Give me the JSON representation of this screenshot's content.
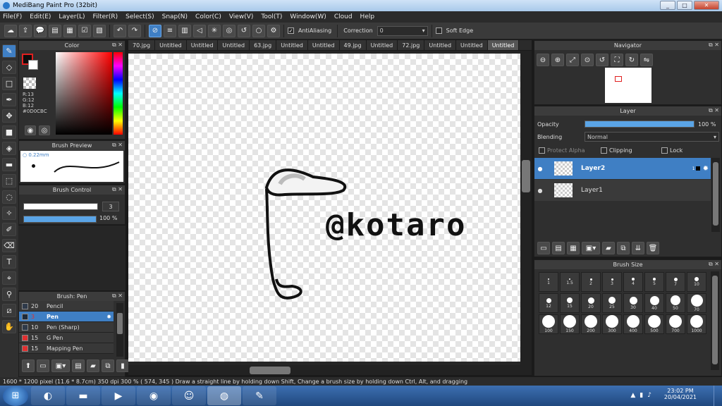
{
  "titlebar": {
    "title": "MediBang Paint Pro (32bit)",
    "min": "_",
    "max": "□",
    "close": "✕"
  },
  "menu": [
    "File(F)",
    "Edit(E)",
    "Layer(L)",
    "Filter(R)",
    "Select(S)",
    "Snap(N)",
    "Color(C)",
    "View(V)",
    "Tool(T)",
    "Window(W)",
    "Cloud",
    "Help"
  ],
  "toolbar": {
    "antialiasing_label": "AntiAliasing",
    "antialiasing_checked": "✓",
    "correction_label": "Correction",
    "correction_value": "0",
    "softedge_label": "Soft Edge"
  },
  "color": {
    "title": "Color",
    "r": "R:13",
    "g": "G:12",
    "b": "B:12",
    "hex": "#0D0CBC"
  },
  "brush_preview": {
    "title": "Brush Preview",
    "size": "0.22mm"
  },
  "brush_control": {
    "title": "Brush Control",
    "size_value": "3",
    "size_fill": 1.0,
    "opacity_value": "100 %",
    "opacity_fill": 1.0
  },
  "brush_list": {
    "title": "Brush: Pen",
    "items": [
      {
        "size": "20",
        "name": "Pencil",
        "color": "#2f3a4a"
      },
      {
        "size": "3",
        "name": "Pen",
        "color": "#1d2a3a"
      },
      {
        "size": "10",
        "name": "Pen (Sharp)",
        "color": "#2f3a4a"
      },
      {
        "size": "15",
        "name": "G Pen",
        "color": "#e03030"
      },
      {
        "size": "15",
        "name": "Mapping Pen",
        "color": "#e03030"
      }
    ]
  },
  "tabs": [
    "70.jpg",
    "Untitled",
    "Untitled",
    "Untitled",
    "63.jpg",
    "Untitled",
    "Untitled",
    "49.jpg",
    "Untitled",
    "72.jpg",
    "Untitled",
    "Untitled",
    "Untitled"
  ],
  "canvas": {
    "text": "@kotaro"
  },
  "navigator": {
    "title": "Navigator"
  },
  "layer": {
    "title": "Layer",
    "opacity_label": "Opacity",
    "opacity_value": "100 %",
    "opacity_fill": 1.0,
    "blending_label": "Blending",
    "blending_value": "Normal",
    "protect_alpha": "Protect Alpha",
    "clipping": "Clipping",
    "lock": "Lock",
    "items": [
      {
        "name": "Layer2",
        "badge": "1"
      },
      {
        "name": "Layer1",
        "badge": ""
      }
    ]
  },
  "brush_size": {
    "title": "Brush Size",
    "sizes": [
      "1",
      "1.5",
      "2",
      "3",
      "4",
      "5",
      "7",
      "10",
      "12",
      "15",
      "20",
      "25",
      "30",
      "40",
      "50",
      "70",
      "100",
      "150",
      "200",
      "300",
      "400",
      "500",
      "700",
      "1000"
    ]
  },
  "status": {
    "text": "1600 * 1200 pixel   (11.6 * 8.7cm)   350 dpi   300 %   ( 574, 345 )   Draw a straight line by holding down Shift, Change a brush size by holding down Ctrl, Alt, and dragging"
  },
  "taskbar": {
    "time": "23:02 PM",
    "date": "20/04/2021"
  },
  "colors": {
    "accent": "#3f7fc4",
    "panel": "#2f2f2f",
    "fg": "#0d0c0c"
  }
}
